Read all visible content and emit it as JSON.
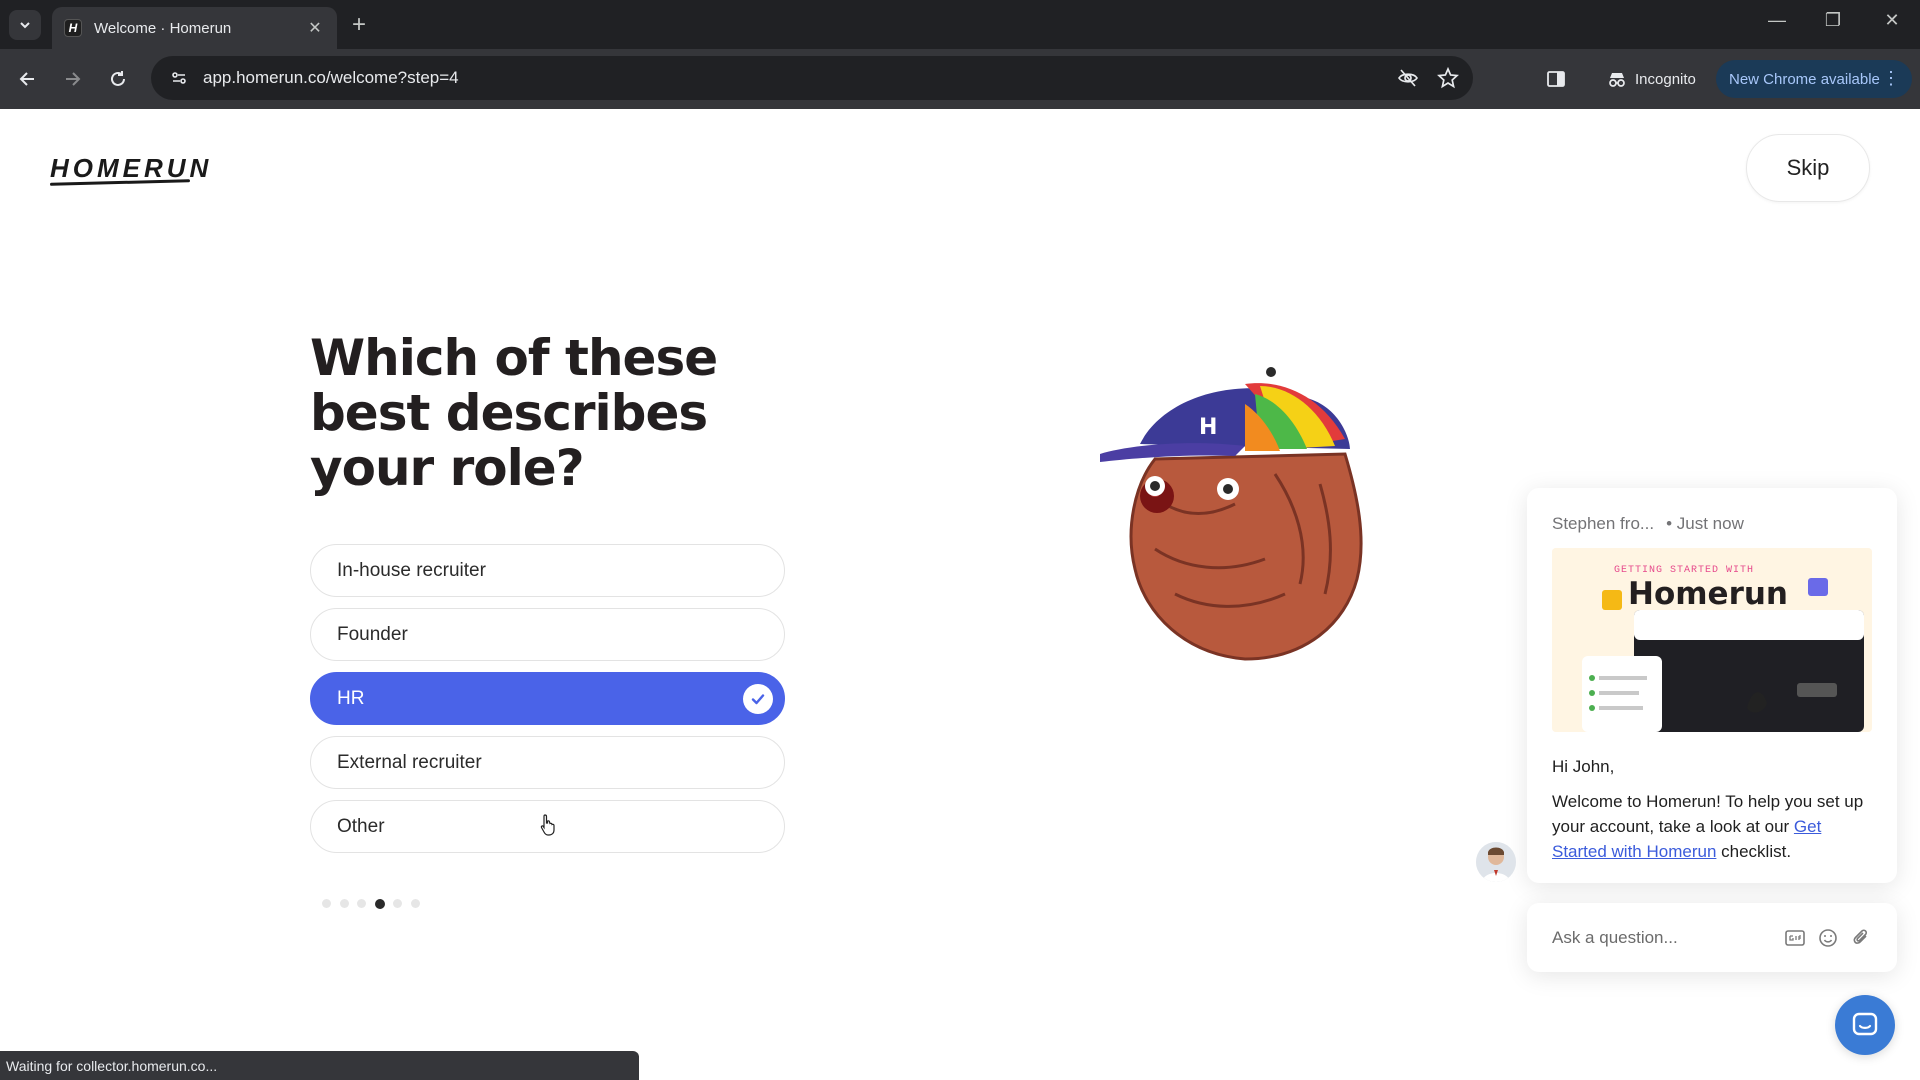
{
  "browser": {
    "tab_title": "Welcome · Homerun",
    "url": "app.homerun.co/welcome?step=4",
    "incognito_label": "Incognito",
    "update_label": "New Chrome available",
    "status_text": "Waiting for collector.homerun.co..."
  },
  "page": {
    "logo": "HOMERUN",
    "skip_label": "Skip",
    "question": "Which of these best describes your role?",
    "options": [
      {
        "label": "In-house recruiter",
        "selected": false
      },
      {
        "label": "Founder",
        "selected": false
      },
      {
        "label": "HR",
        "selected": true
      },
      {
        "label": "External recruiter",
        "selected": false
      },
      {
        "label": "Other",
        "selected": false
      }
    ],
    "steps_total": 6,
    "step_current": 4,
    "colors": {
      "accent": "#4a63e8",
      "text": "#231f20",
      "launcher": "#3a7bd5"
    }
  },
  "chat": {
    "sender": "Stephen fro...",
    "time": "• Just now",
    "image_tagline": "GETTING STARTED WITH",
    "image_brand": "Homerun",
    "greeting": "Hi John,",
    "message_before": "Welcome to Homerun! To help you set up your account, take a look at our ",
    "link_text": "Get Started with Homerun",
    "message_after": " checklist.",
    "input_placeholder": "Ask a question..."
  }
}
